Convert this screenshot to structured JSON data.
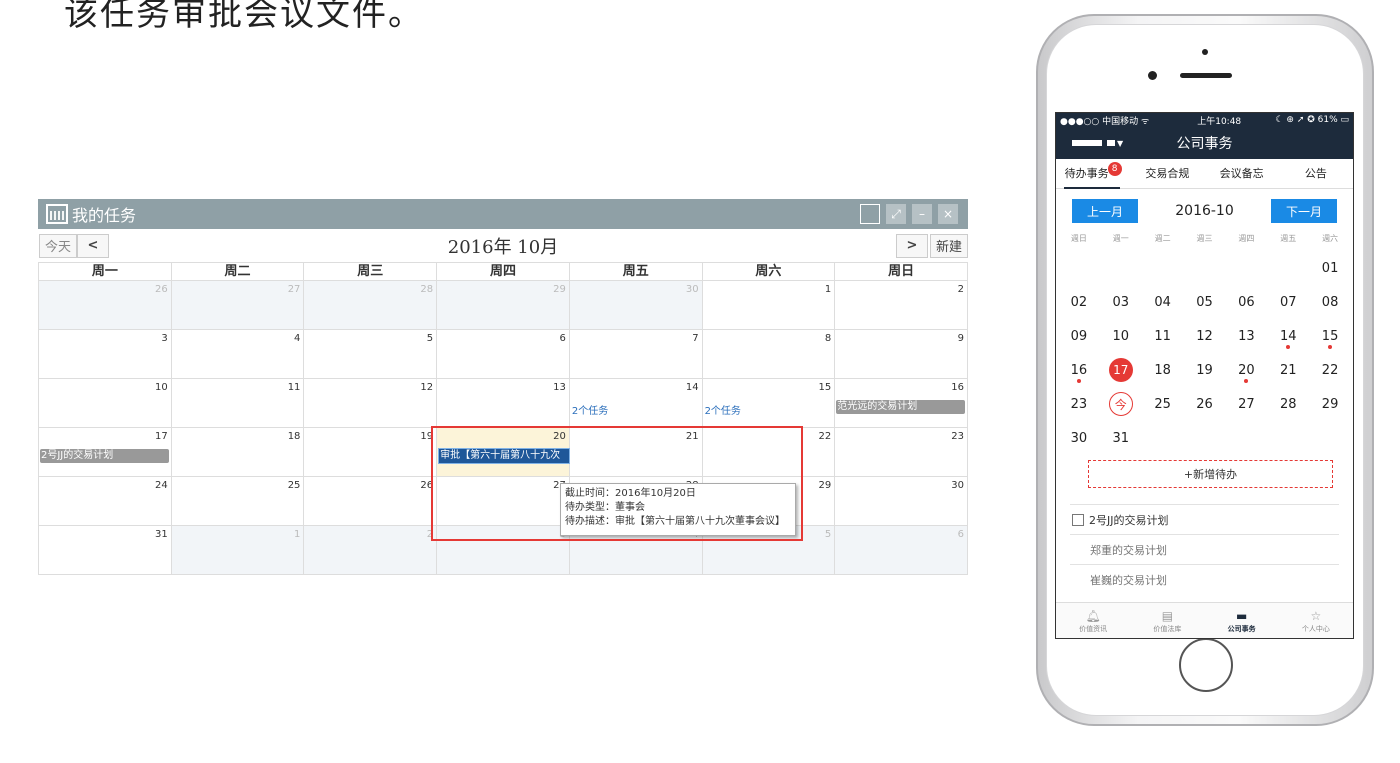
{
  "heading": "该任务审批会议文件。",
  "desktop": {
    "window_title": "我的任务",
    "toolbar": {
      "today": "今天",
      "prev": "<",
      "next": ">",
      "new": "新建",
      "month_title": "2016年 10月"
    },
    "weekday_headers": [
      "周一",
      "周二",
      "周三",
      "周四",
      "周五",
      "周六",
      "周日"
    ],
    "weeks": [
      [
        "26",
        "27",
        "28",
        "29",
        "30",
        "1",
        "2"
      ],
      [
        "3",
        "4",
        "5",
        "6",
        "7",
        "8",
        "9"
      ],
      [
        "10",
        "11",
        "12",
        "13",
        "14",
        "15",
        "16"
      ],
      [
        "17",
        "18",
        "19",
        "20",
        "21",
        "22",
        "23"
      ],
      [
        "24",
        "25",
        "26",
        "27",
        "28",
        "29",
        "30"
      ],
      [
        "31",
        "1",
        "2",
        "3",
        "4",
        "5",
        "6"
      ]
    ],
    "events": {
      "oct14": "2个任务",
      "oct15": "2个任务",
      "oct16": "范光远的交易计划",
      "oct17": "2号JJ的交易计划",
      "oct20": "审批【第六十届第八十九次"
    },
    "tooltip": {
      "line1": "截止时间：2016年10月20日",
      "line2": "待办类型：董事会",
      "line3": "待办描述：审批【第六十届第八十九次董事会议】"
    }
  },
  "phone": {
    "status": {
      "left": "●●●○○ 中国移动 ᯤ",
      "time": "上午10:48",
      "right": "☾ ⊕ ➚ ✪ 61% ▭"
    },
    "nav_title": "公司事务",
    "tabs": [
      {
        "label": "待办事务",
        "badge": "8"
      },
      {
        "label": "交易合规"
      },
      {
        "label": "会议备忘"
      },
      {
        "label": "公告"
      }
    ],
    "prev_month": "上一月",
    "month": "2016-10",
    "next_month": "下一月",
    "weekdays": [
      "週日",
      "週一",
      "週二",
      "週三",
      "週四",
      "週五",
      "週六"
    ],
    "days": [
      "",
      "",
      "",
      "",
      "",
      "",
      "01",
      "02",
      "03",
      "04",
      "05",
      "06",
      "07",
      "08",
      "09",
      "10",
      "11",
      "12",
      "13",
      "14",
      "15",
      "16",
      "17",
      "18",
      "19",
      "20",
      "21",
      "22",
      "23",
      "今",
      "25",
      "26",
      "27",
      "28",
      "29",
      "30",
      "31",
      "",
      "",
      "",
      "",
      ""
    ],
    "add_todo": "+新增待办",
    "tasks": [
      "2号JJ的交易计划",
      "郑重的交易计划",
      "崔巍的交易计划"
    ],
    "tabbar": [
      {
        "label": "价值资讯",
        "icon": "bell-icon"
      },
      {
        "label": "价值法库",
        "icon": "book-icon"
      },
      {
        "label": "公司事务",
        "icon": "folder-icon"
      },
      {
        "label": "个人中心",
        "icon": "star-icon"
      }
    ],
    "accent": "#1a8ae5",
    "alert": "#e53935",
    "navy": "#1d2b3c"
  }
}
